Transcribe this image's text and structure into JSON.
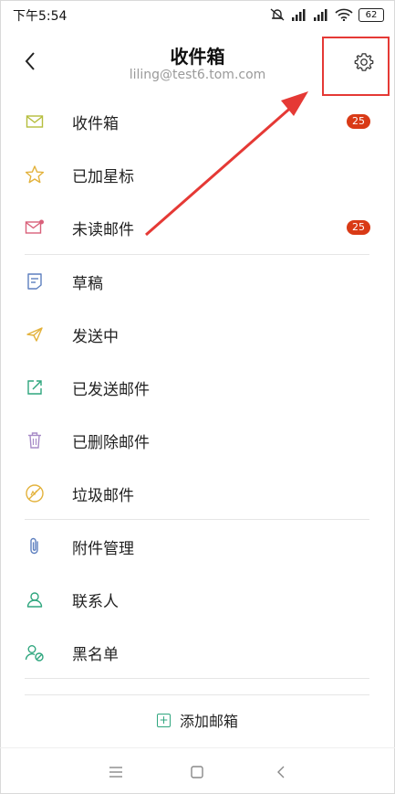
{
  "status_bar": {
    "time": "下午5:54",
    "battery": "62"
  },
  "header": {
    "title": "收件箱",
    "account": "liling@test6.tom.com"
  },
  "folders": [
    {
      "label": "收件箱",
      "icon": "envelope-icon",
      "badge": "25",
      "color": "#b5bd3c"
    },
    {
      "label": "已加星标",
      "icon": "star-icon",
      "badge": null,
      "color": "#e3b23c"
    },
    {
      "label": "未读邮件",
      "icon": "unread-mail-icon",
      "badge": "25",
      "color": "#d9607a"
    }
  ],
  "local": [
    {
      "label": "草稿",
      "icon": "draft-icon",
      "color": "#5d7fbf"
    },
    {
      "label": "发送中",
      "icon": "paper-plane-icon",
      "color": "#e3b23c"
    },
    {
      "label": "已发送邮件",
      "icon": "sent-icon",
      "color": "#2fa67e"
    },
    {
      "label": "已删除邮件",
      "icon": "trash-icon",
      "color": "#a78bc7"
    },
    {
      "label": "垃圾邮件",
      "icon": "spam-icon",
      "color": "#e3b23c"
    }
  ],
  "tools": [
    {
      "label": "附件管理",
      "icon": "paperclip-icon",
      "color": "#5d7fbf"
    },
    {
      "label": "联系人",
      "icon": "contact-icon",
      "color": "#2fa67e"
    },
    {
      "label": "黑名单",
      "icon": "blacklist-icon",
      "color": "#2fa67e"
    }
  ],
  "add_mailbox": {
    "label": "添加邮箱"
  },
  "colors": {
    "badge": "#d93a16",
    "highlight": "#e53935",
    "accent": "#2fa67e"
  }
}
